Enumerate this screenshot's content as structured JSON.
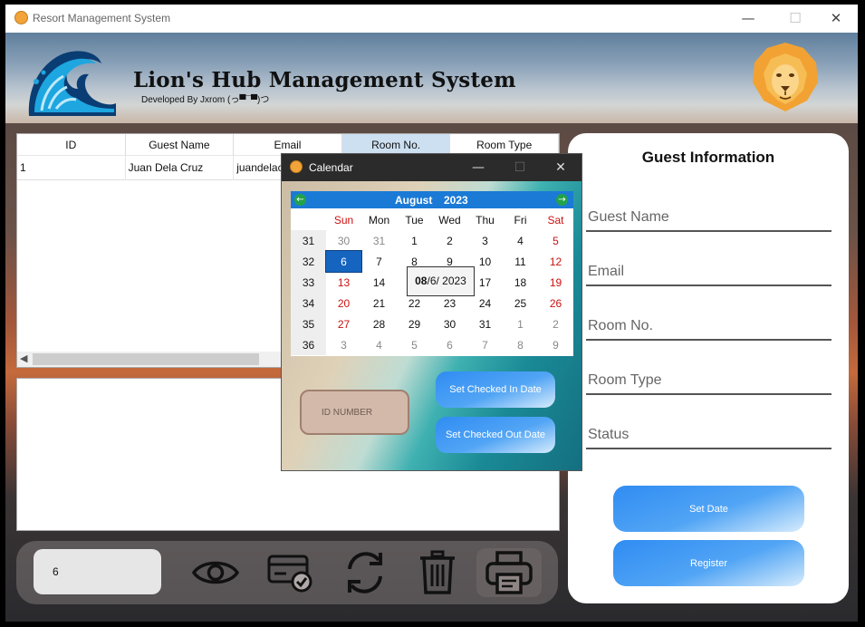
{
  "window": {
    "title": "Resort Management System",
    "minimize": "—",
    "maximize": "☐",
    "close": "✕"
  },
  "header": {
    "title": "Lion's Hub Management System",
    "subtitle": "Developed By Jxrom (っ▀¯▀)つ"
  },
  "grid": {
    "columns": [
      "ID",
      "Guest Name",
      "Email",
      "Room No.",
      "Room Type"
    ],
    "rows": [
      [
        "1",
        "Juan Dela Cruz",
        "juandelacruz@",
        "",
        ""
      ]
    ]
  },
  "toolbar": {
    "id_value": "6",
    "icons": [
      "eye-icon",
      "card-check-icon",
      "refresh-icon",
      "trash-icon",
      "printer-icon"
    ]
  },
  "guest_info": {
    "title": "Guest Information",
    "fields": [
      "Guest Name",
      "Email",
      "Room No.",
      "Room Type",
      "Status"
    ],
    "set_date": "Set Date",
    "register": "Register"
  },
  "calendar_dialog": {
    "title": "Calendar",
    "minimize": "—",
    "maximize": "☐",
    "close": "✕",
    "month": "August",
    "year": "2023",
    "weekdays": [
      "Sun",
      "Mon",
      "Tue",
      "Wed",
      "Thu",
      "Fri",
      "Sat"
    ],
    "weeks": [
      {
        "num": "31",
        "days": [
          "30",
          "31",
          "1",
          "2",
          "3",
          "4",
          "5"
        ]
      },
      {
        "num": "32",
        "days": [
          "6",
          "7",
          "8",
          "9",
          "10",
          "11",
          "12"
        ]
      },
      {
        "num": "33",
        "days": [
          "13",
          "14",
          "15",
          "16",
          "17",
          "18",
          "19"
        ]
      },
      {
        "num": "34",
        "days": [
          "20",
          "21",
          "22",
          "23",
          "24",
          "25",
          "26"
        ]
      },
      {
        "num": "35",
        "days": [
          "27",
          "28",
          "29",
          "30",
          "31",
          "1",
          "2"
        ]
      },
      {
        "num": "36",
        "days": [
          "3",
          "4",
          "5",
          "6",
          "7",
          "8",
          "9"
        ]
      }
    ],
    "selected_day": "6",
    "date_popup_month": "08",
    "date_popup_rest": "/6/ 2023",
    "id_number_placeholder": "ID NUMBER",
    "set_checked_in": "Set Checked In Date",
    "set_checked_out": "Set Checked Out Date"
  },
  "colors": {
    "accent_blue": "#2f8cf2",
    "calendar_nav": "#1b7ad6",
    "weekend_red": "#cc1010"
  }
}
